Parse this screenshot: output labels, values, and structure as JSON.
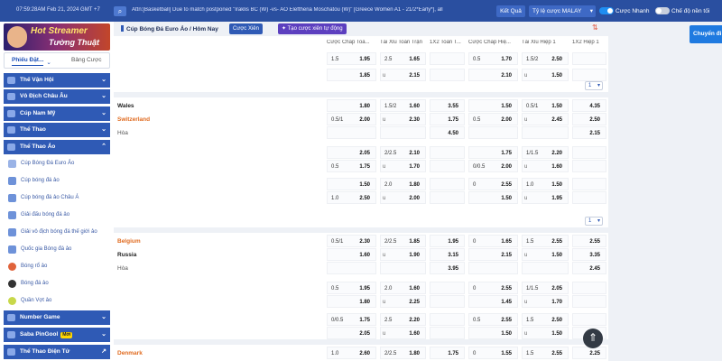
{
  "topbar": {
    "clock": "07:59:28AM Feb 21, 2024 GMT +7",
    "ticker": "Attn:[Basketball] Due to match postponed \"Iraklis BC (W) -vs- AO Eleftheria Moschatou (W)\" [Greece Women A1 - 21/2*Early*], all",
    "results_label": "Kết Quả",
    "odds_label": "Tỷ lệ cược MALAY",
    "fast_label": "Cược Nhanh",
    "night_label": "Chế độ nền tối"
  },
  "sidebar": {
    "promo_line1": "Hot Streamer",
    "promo_line2": "Tường Thuật",
    "tab_bets": "Phiếu Đặt...",
    "tab_table": "Bảng Cược",
    "sections": [
      {
        "label": "Thế Vận Hội"
      },
      {
        "label": "Vô Địch Châu Âu"
      },
      {
        "label": "Cúp Nam Mỹ"
      },
      {
        "label": "Thể Thao"
      },
      {
        "label": "Thể Thao Ảo"
      }
    ],
    "items": [
      {
        "label": "Cúp Bóng Đá Euro Ảo"
      },
      {
        "label": "Cúp bóng đá ảo"
      },
      {
        "label": "Cúp bóng đá ảo Châu Á"
      },
      {
        "label": "Giải đấu bóng đá ảo"
      },
      {
        "label": "Giải vô địch bóng đá thế giới ảo"
      },
      {
        "label": "Quốc gia Bóng đá ảo"
      },
      {
        "label": "Bóng rổ ảo"
      },
      {
        "label": "Bóng đá ảo"
      },
      {
        "label": "Quần Vợt ảo"
      }
    ],
    "bottom": [
      {
        "label": "Number Game"
      },
      {
        "label": "Saba PinGool",
        "badge": "Mới"
      },
      {
        "label": "Thể Thao Điện Tử"
      }
    ]
  },
  "main": {
    "title": "Cúp Bóng Đá Euro Ảo / Hôm Nay",
    "live_label": "Cược Xiên",
    "create_label": "Tạo cược xiên tự động",
    "columns": [
      "Cược Chấp Toà...",
      "Tài Xỉu Toàn Trận",
      "1X2 Toàn T...",
      "Cược Chấp Hiệ...",
      "Tài Xỉu Hiệp 1",
      "1X2 Hiệp 1"
    ],
    "page_select": "1",
    "blocks": [
      {
        "team_home": "",
        "team_away": "",
        "draw": "",
        "rows": [
          [
            "1.5",
            "1.95",
            "2.5",
            "1.65",
            "",
            "0.5",
            "1.70",
            "1.5/2",
            "2.50",
            ""
          ],
          [
            "",
            "1.85",
            "u",
            "2.15",
            "",
            "",
            "2.10",
            "u",
            "1.50",
            ""
          ]
        ]
      },
      {
        "team_home": "Wales",
        "team_away": "Switzerland",
        "draw": "Hòa",
        "rows": [
          [
            "",
            "1.80",
            "1.5/2",
            "1.60",
            "3.55",
            "",
            "1.50",
            "0.5/1",
            "1.50",
            "4.35"
          ],
          [
            "0.5/1",
            "2.00",
            "u",
            "2.30",
            "1.75",
            "0.5",
            "2.00",
            "u",
            "2.45",
            "2.50"
          ],
          [
            "",
            "",
            "",
            "",
            "4.50",
            "",
            "",
            "",
            "",
            "2.15"
          ],
          [
            "",
            "2.05",
            "2/2.5",
            "2.10",
            "",
            "",
            "1.75",
            "1/1.5",
            "2.20",
            ""
          ],
          [
            "0.5",
            "1.75",
            "u",
            "1.70",
            "",
            "0/0.5",
            "2.00",
            "u",
            "1.60",
            ""
          ],
          [
            "",
            "1.50",
            "2.0",
            "1.80",
            "",
            "0",
            "2.55",
            "1.0",
            "1.50",
            ""
          ],
          [
            "1.0",
            "2.50",
            "u",
            "2.00",
            "",
            "",
            "1.50",
            "u",
            "1.95",
            ""
          ]
        ]
      },
      {
        "team_home": "Belgium",
        "team_away": "Russia",
        "draw": "Hòa",
        "rows": [
          [
            "0.5/1",
            "2.30",
            "2/2.5",
            "1.85",
            "1.95",
            "0",
            "1.65",
            "1.5",
            "2.55",
            "2.55"
          ],
          [
            "",
            "1.60",
            "u",
            "1.90",
            "3.15",
            "",
            "2.15",
            "u",
            "1.50",
            "3.35"
          ],
          [
            "",
            "",
            "",
            "",
            "3.95",
            "",
            "",
            "",
            "",
            "2.45"
          ],
          [
            "0.5",
            "1.95",
            "2.0",
            "1.60",
            "",
            "0",
            "2.55",
            "1/1.5",
            "2.05",
            ""
          ],
          [
            "",
            "1.80",
            "u",
            "2.25",
            "",
            "",
            "1.45",
            "u",
            "1.70",
            ""
          ],
          [
            "0/0.5",
            "1.75",
            "2.5",
            "2.20",
            "",
            "0.5",
            "2.55",
            "1.5",
            "2.50",
            ""
          ],
          [
            "",
            "2.05",
            "u",
            "1.60",
            "",
            "",
            "1.50",
            "u",
            "1.50",
            ""
          ]
        ]
      },
      {
        "team_home": "Denmark",
        "team_away": "",
        "draw": "",
        "rows": [
          [
            "1.0",
            "2.60",
            "2/2.5",
            "1.80",
            "1.75",
            "0",
            "1.55",
            "1.5",
            "2.55",
            "2.25"
          ]
        ]
      }
    ]
  },
  "right_button": "Chuyển đi",
  "colors": {
    "topbar": "#2a4fa0",
    "sidebar_head": "#2f5ab5",
    "favorite": "#e06b20"
  }
}
